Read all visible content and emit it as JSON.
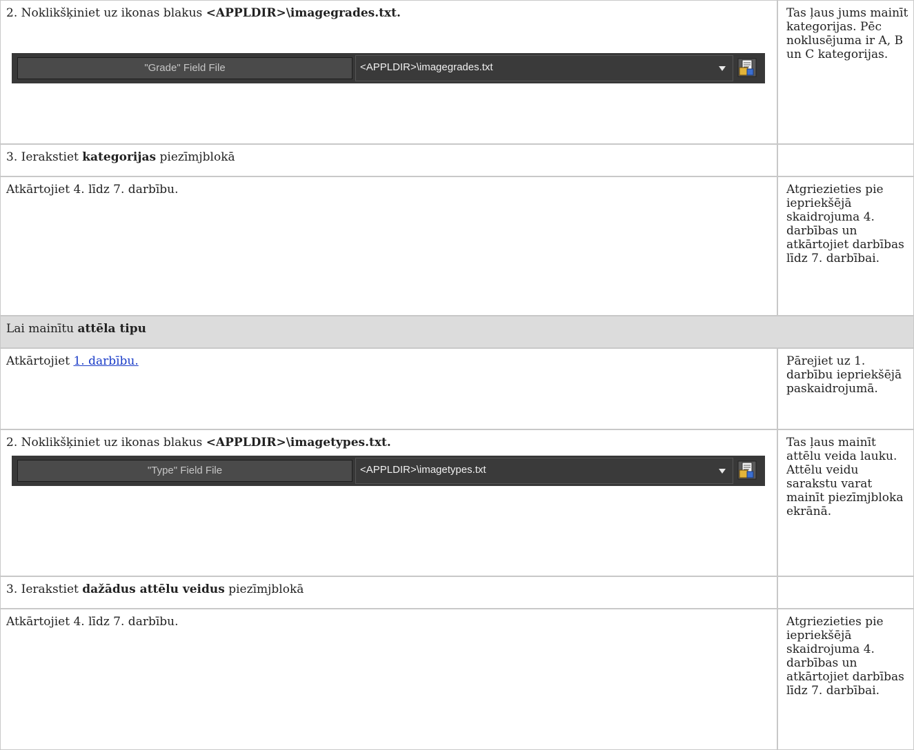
{
  "sec1": {
    "step2": {
      "prefix": "2. Noklikšķiniet uz ikonas blakus ",
      "bold": "<APPLDIR>\\imagegrades.txt.",
      "note": "Tas ļaus jums mainīt kategorijas. Pēc noklusējuma ir A, B un C kategorijas.",
      "widget": {
        "label": "\"Grade\" Field File",
        "value": "<APPLDIR>\\imagegrades.txt"
      }
    },
    "step3": {
      "prefix": "3. Ierakstiet ",
      "bold": "kategorijas",
      "suffix": " piezīmjblokā",
      "note": ""
    },
    "repeat": {
      "text": "Atkārtojiet 4. līdz 7. darbību.",
      "note": "Atgriezieties pie iepriekšējā skaidrojuma 4. darbības un atkārtojiet darbības līdz 7. darbībai."
    }
  },
  "sec2": {
    "header": {
      "prefix": "Lai mainītu ",
      "bold": "attēla tipu"
    },
    "step1": {
      "prefix": "Atkārtojiet ",
      "link": "1. darbību.",
      "note": "Pārejiet uz 1. darbību iepriekšējā paskaidrojumā."
    },
    "step2": {
      "prefix": "2. Noklikšķiniet uz ikonas blakus ",
      "bold": "<APPLDIR>\\imagetypes.txt.",
      "note": "Tas ļaus mainīt attēlu veida lauku. Attēlu veidu sarakstu varat mainīt piezīmjbloka ekrānā.",
      "widget": {
        "label": "\"Type\" Field File",
        "value": "<APPLDIR>\\imagetypes.txt"
      }
    },
    "step3": {
      "prefix": "3. Ierakstiet ",
      "bold": "dažādus attēlu veidus",
      "suffix": " piezīmjblokā",
      "note": ""
    },
    "repeat": {
      "text": "Atkārtojiet 4. līdz 7. darbību.",
      "note": "Atgriezieties pie iepriekšējā skaidrojuma 4. darbības un atkārtojiet darbības līdz 7. darbībai."
    }
  },
  "icons": {
    "field_file_button": "open-notepad-icon",
    "dropdown": "chevron-down-icon"
  },
  "colors": {
    "link": "#1a3cc8",
    "header_bg": "#dcdcdc",
    "widget_bg": "#383838"
  }
}
